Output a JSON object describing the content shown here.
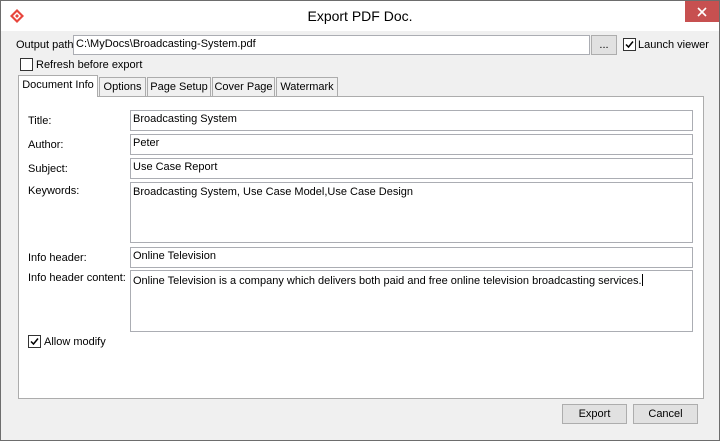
{
  "window": {
    "title": "Export PDF Doc.",
    "close_icon": "close-icon",
    "app_icon": "app-logo-icon"
  },
  "output": {
    "label": "Output path:",
    "value": "C:\\MyDocs\\Broadcasting-System.pdf",
    "browse_label": "...",
    "launch_viewer_label": "Launch viewer",
    "launch_viewer_checked": true
  },
  "refresh": {
    "label": "Refresh before export",
    "checked": false
  },
  "tabs": [
    {
      "label": "Document Info",
      "active": true
    },
    {
      "label": "Options",
      "active": false
    },
    {
      "label": "Page Setup",
      "active": false
    },
    {
      "label": "Cover Page",
      "active": false
    },
    {
      "label": "Watermark",
      "active": false
    }
  ],
  "doc_info": {
    "title_label": "Title:",
    "title_value": "Broadcasting System",
    "author_label": "Author:",
    "author_value": "Peter",
    "subject_label": "Subject:",
    "subject_value": "Use Case Report",
    "keywords_label": "Keywords:",
    "keywords_value": "Broadcasting System, Use Case Model,Use Case Design",
    "info_header_label": "Info header:",
    "info_header_value": "Online Television",
    "info_header_content_label": "Info header content:",
    "info_header_content_value": "Online Television is a company which delivers both paid and free online television broadcasting services.",
    "allow_modify_label": "Allow modify",
    "allow_modify_checked": true
  },
  "footer": {
    "export_label": "Export",
    "cancel_label": "Cancel"
  },
  "colors": {
    "close_button": "#c75050",
    "app_icon": "#e8453c"
  }
}
